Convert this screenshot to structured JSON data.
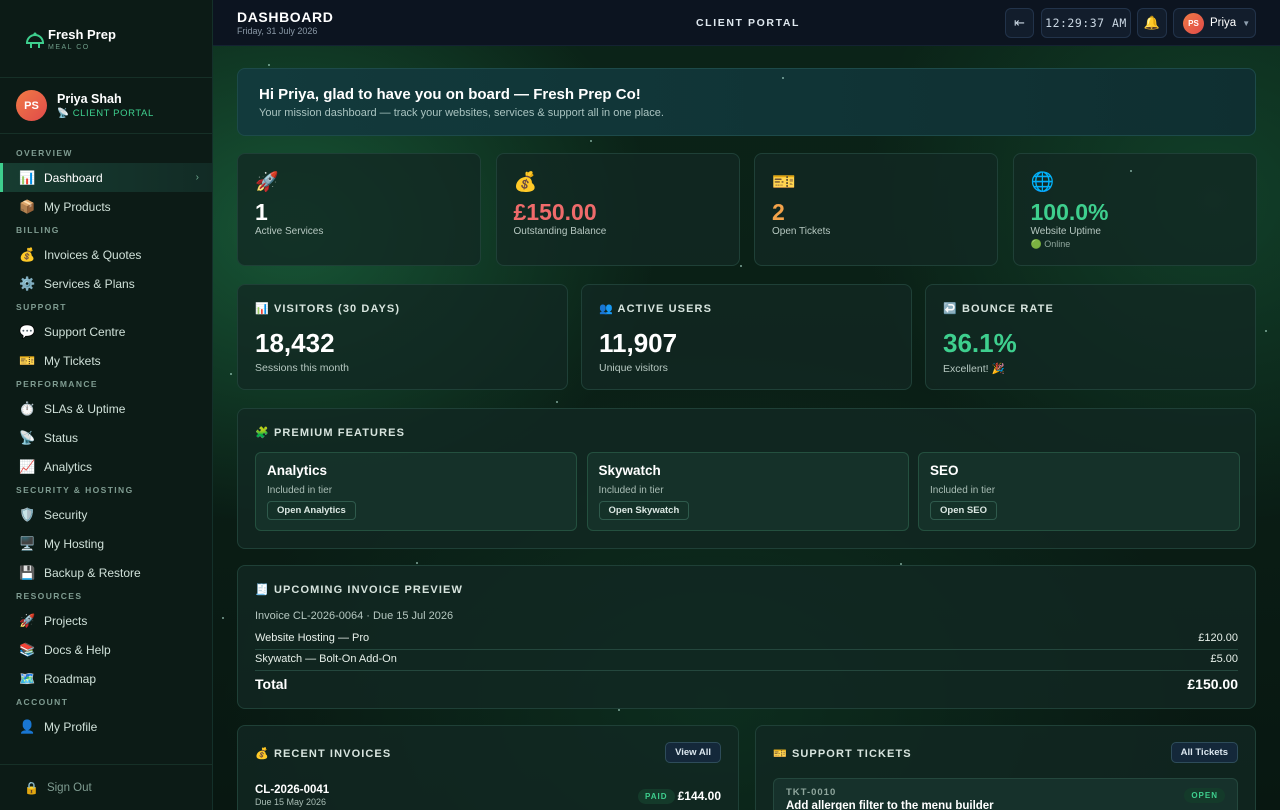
{
  "brand": {
    "name": "Fresh Prep",
    "sub": "MEAL CO",
    "icon": "bell-cloche-icon"
  },
  "user": {
    "initials": "PS",
    "name": "Priya Shah",
    "role": "CLIENT PORTAL",
    "role_icon": "satellite-icon"
  },
  "sidebar": {
    "sections": [
      {
        "title": "OVERVIEW",
        "items": [
          {
            "label": "Dashboard",
            "icon": "📊"
          },
          {
            "label": "My Products",
            "icon": "📦"
          }
        ]
      },
      {
        "title": "BILLING",
        "items": [
          {
            "label": "Invoices & Quotes",
            "icon": "💰"
          },
          {
            "label": "Services & Plans",
            "icon": "⚙️"
          }
        ]
      },
      {
        "title": "SUPPORT",
        "items": [
          {
            "label": "Support Centre",
            "icon": "💬"
          },
          {
            "label": "My Tickets",
            "icon": "🎫"
          }
        ]
      },
      {
        "title": "PERFORMANCE",
        "items": [
          {
            "label": "SLAs & Uptime",
            "icon": "⏱️"
          },
          {
            "label": "Status",
            "icon": "📡"
          },
          {
            "label": "Analytics",
            "icon": "📈"
          }
        ]
      },
      {
        "title": "SECURITY & HOSTING",
        "items": [
          {
            "label": "Security",
            "icon": "🛡️"
          },
          {
            "label": "My Hosting",
            "icon": "🖥️"
          },
          {
            "label": "Backup & Restore",
            "icon": "💾"
          }
        ]
      },
      {
        "title": "RESOURCES",
        "items": [
          {
            "label": "Projects",
            "icon": "🚀"
          },
          {
            "label": "Docs & Help",
            "icon": "📚"
          },
          {
            "label": "Roadmap",
            "icon": "🗺️"
          }
        ]
      },
      {
        "title": "ACCOUNT",
        "items": [
          {
            "label": "My Profile",
            "icon": "👤"
          }
        ]
      }
    ],
    "signout": "Sign Out"
  },
  "topbar": {
    "title": "DASHBOARD",
    "date": "Friday, 31 July 2026",
    "portal": "CLIENT PORTAL",
    "clock": "12:29:37 AM",
    "user_initials": "PS",
    "user_name": "Priya"
  },
  "welcome": {
    "title": "Hi Priya, glad to have you on board — Fresh Prep Co!",
    "subtitle": "Your mission dashboard — track your websites, services & support all in one place."
  },
  "stats": [
    {
      "icon": "🚀",
      "value": "1",
      "label": "Active Services",
      "color": "#ffffff"
    },
    {
      "icon": "💰",
      "value": "£150.00",
      "label": "Outstanding Balance",
      "color": "#ef6b6b"
    },
    {
      "icon": "🎫",
      "value": "2",
      "label": "Open Tickets",
      "color": "#f3a24a"
    },
    {
      "icon": "🌐",
      "value": "100.0%",
      "label": "Website Uptime",
      "color": "#3ecf8e",
      "extra": "🟢 Online"
    }
  ],
  "metrics": [
    {
      "title": "📊 VISITORS (30 DAYS)",
      "value": "18,432",
      "label": "Sessions this month",
      "color": "#ffffff"
    },
    {
      "title": "👥 ACTIVE USERS",
      "value": "11,907",
      "label": "Unique visitors",
      "color": "#ffffff"
    },
    {
      "title": "↩️ BOUNCE RATE",
      "value": "36.1%",
      "label": "Excellent! 🎉",
      "color": "#3ecf8e"
    }
  ],
  "premium": {
    "title": "🧩 PREMIUM FEATURES",
    "features": [
      {
        "name": "Analytics",
        "sub": "Included in tier",
        "button": "Open Analytics"
      },
      {
        "name": "Skywatch",
        "sub": "Included in tier",
        "button": "Open Skywatch"
      },
      {
        "name": "SEO",
        "sub": "Included in tier",
        "button": "Open SEO"
      }
    ]
  },
  "invoice_preview": {
    "title": "🧾 UPCOMING INVOICE PREVIEW",
    "meta": "Invoice CL-2026-0064 · Due 15 Jul 2026",
    "lines": [
      {
        "label": "Website Hosting — Pro",
        "amount": "£120.00"
      },
      {
        "label": "Skywatch — Bolt-On Add-On",
        "amount": "£5.00"
      }
    ],
    "total_label": "Total",
    "total": "£150.00"
  },
  "recent_invoices": {
    "title": "💰 RECENT INVOICES",
    "button": "View All",
    "rows": [
      {
        "id": "CL-2026-0041",
        "due": "Due 15 May 2026",
        "status": "PAID",
        "amount": "£144.00"
      }
    ]
  },
  "support_tickets": {
    "title": "🎫 SUPPORT TICKETS",
    "button": "All Tickets",
    "rows": [
      {
        "id": "TKT-0010",
        "subject": "Add allergen filter to the menu builder",
        "status": "OPEN"
      }
    ]
  }
}
